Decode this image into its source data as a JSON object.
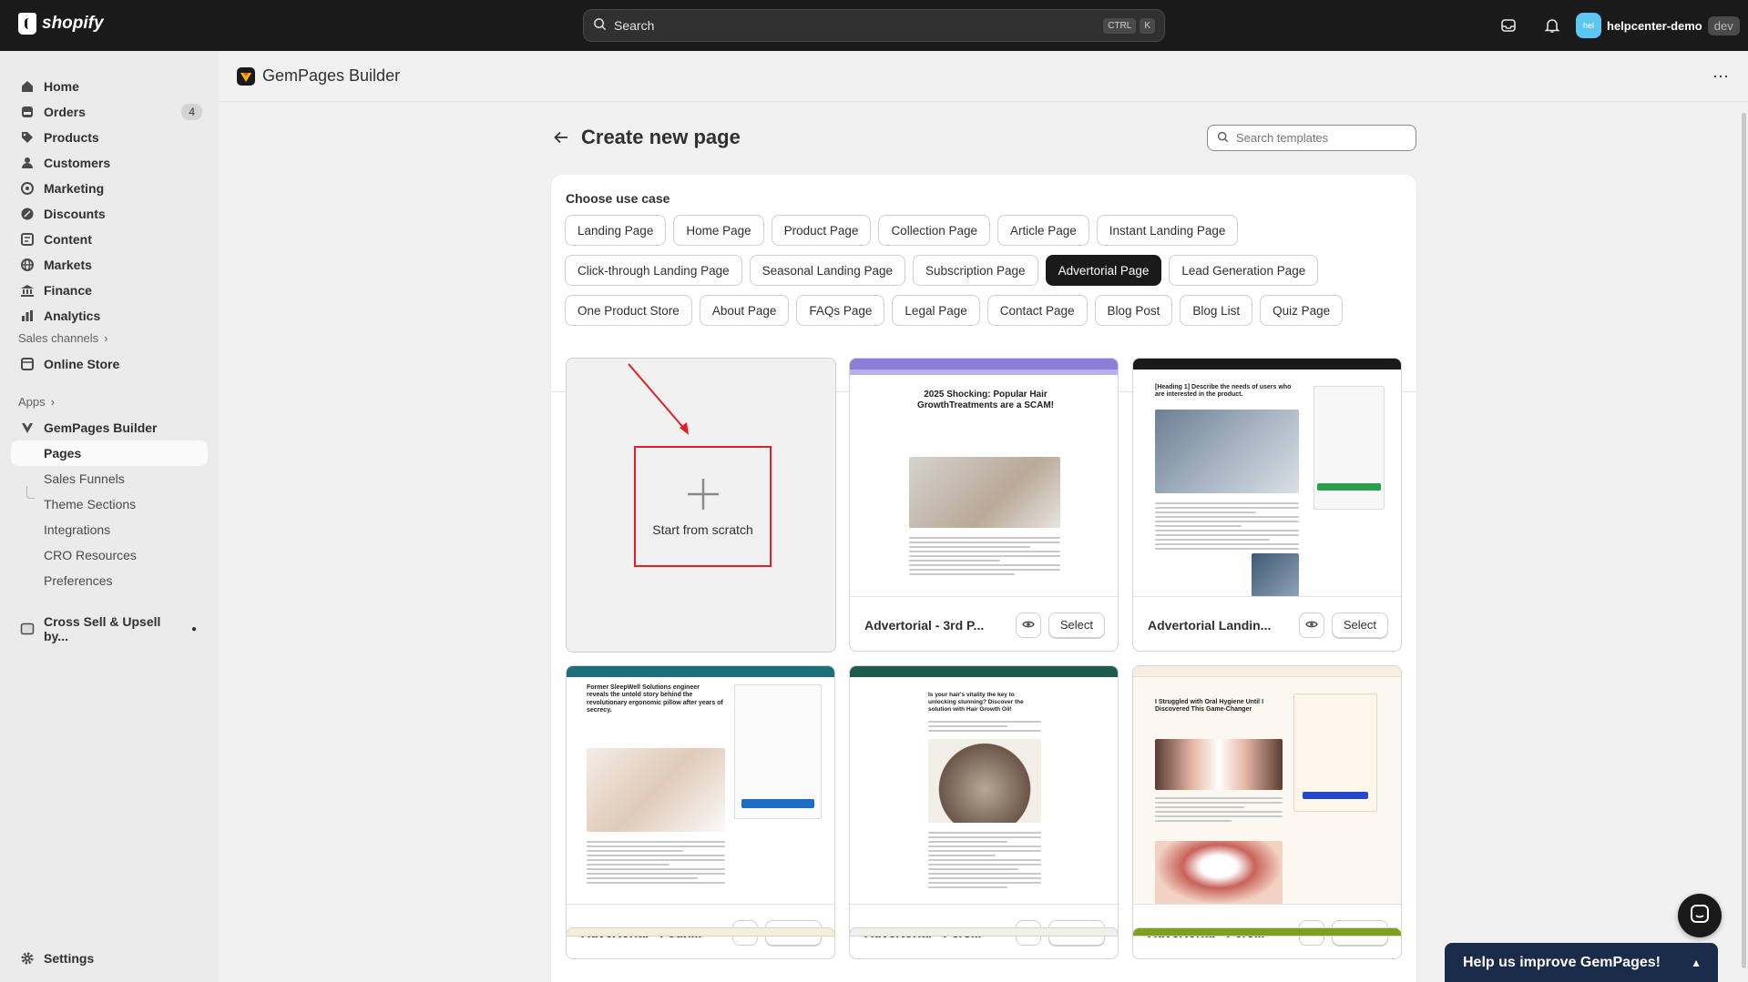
{
  "topbar": {
    "brand": "shopify",
    "search_label": "Search",
    "search_kbd": [
      "CTRL",
      "K"
    ],
    "store_avatar": "hel",
    "store_name": "helpcenter-demo",
    "store_badge": "dev"
  },
  "sidebar": {
    "items": [
      {
        "label": "Home",
        "icon": "home-icon"
      },
      {
        "label": "Orders",
        "icon": "orders-icon",
        "count": "4"
      },
      {
        "label": "Products",
        "icon": "tag-icon"
      },
      {
        "label": "Customers",
        "icon": "person-icon"
      },
      {
        "label": "Marketing",
        "icon": "target-icon"
      },
      {
        "label": "Discounts",
        "icon": "discount-icon"
      },
      {
        "label": "Content",
        "icon": "content-icon"
      },
      {
        "label": "Markets",
        "icon": "globe-icon"
      },
      {
        "label": "Finance",
        "icon": "bank-icon"
      },
      {
        "label": "Analytics",
        "icon": "chart-icon"
      }
    ],
    "sales_channels_label": "Sales channels",
    "online_store": "Online Store",
    "apps_label": "Apps",
    "gempages": "GemPages Builder",
    "gempages_sub": [
      "Pages",
      "Sales Funnels",
      "Theme Sections",
      "Integrations",
      "CRO Resources",
      "Preferences"
    ],
    "cross_sell": "Cross Sell & Upsell by...",
    "settings": "Settings"
  },
  "app": {
    "title": "GemPages Builder"
  },
  "page": {
    "title": "Create new page",
    "search_placeholder": "Search templates",
    "use_case_title": "Choose use case",
    "chip_rows": [
      [
        "Landing Page",
        "Home Page",
        "Product Page",
        "Collection Page",
        "Article Page",
        "Instant Landing Page"
      ],
      [
        "Click-through Landing Page",
        "Seasonal Landing Page",
        "Subscription Page",
        "Advertorial Page",
        "Lead Generation Page"
      ],
      [
        "One Product Store",
        "About Page",
        "FAQs Page",
        "Legal Page",
        "Contact Page",
        "Blog Post",
        "Blog List",
        "Quiz Page"
      ]
    ],
    "selected_chip": "Advertorial Page",
    "scratch_label": "Start from scratch",
    "select_label": "Select",
    "templates": [
      {
        "name": "Advertorial - 3rd P...",
        "headline": "2025 Shocking: Popular Hair GrowthTreatments are a SCAM!",
        "accent": "#8c7fd6"
      },
      {
        "name": "Advertorial Landin...",
        "headline": "[Heading 1] Describe the needs of users who are interested in the product.",
        "accent": "#1a1a1a"
      },
      {
        "name": "Advertorial - Foun...",
        "headline": "Former SleepWell Solutions engineer reveals the untold story behind the revolutionary ergonomic pillow after years of secrecy.",
        "accent": "#1b6e7a"
      },
      {
        "name": "Advertorial - Pers...",
        "headline": "Is your hair's vitality the key to unlocking stunning? Discover the solution with Hair Growth Oil!",
        "accent": "#1f5a4f"
      },
      {
        "name": "Advertorial - Pers...",
        "headline": "I Struggled with Oral Hygiene Until I Discovered This Game-Changer",
        "accent": "#f7ede0"
      }
    ]
  },
  "feedback": {
    "label": "Help us improve GemPages!"
  },
  "colors": {
    "topbar": "#1a1a1a",
    "selected_chip": "#1a1a1a",
    "highlight_red": "#e01f26",
    "feedback_bg": "#1b2b4a"
  }
}
